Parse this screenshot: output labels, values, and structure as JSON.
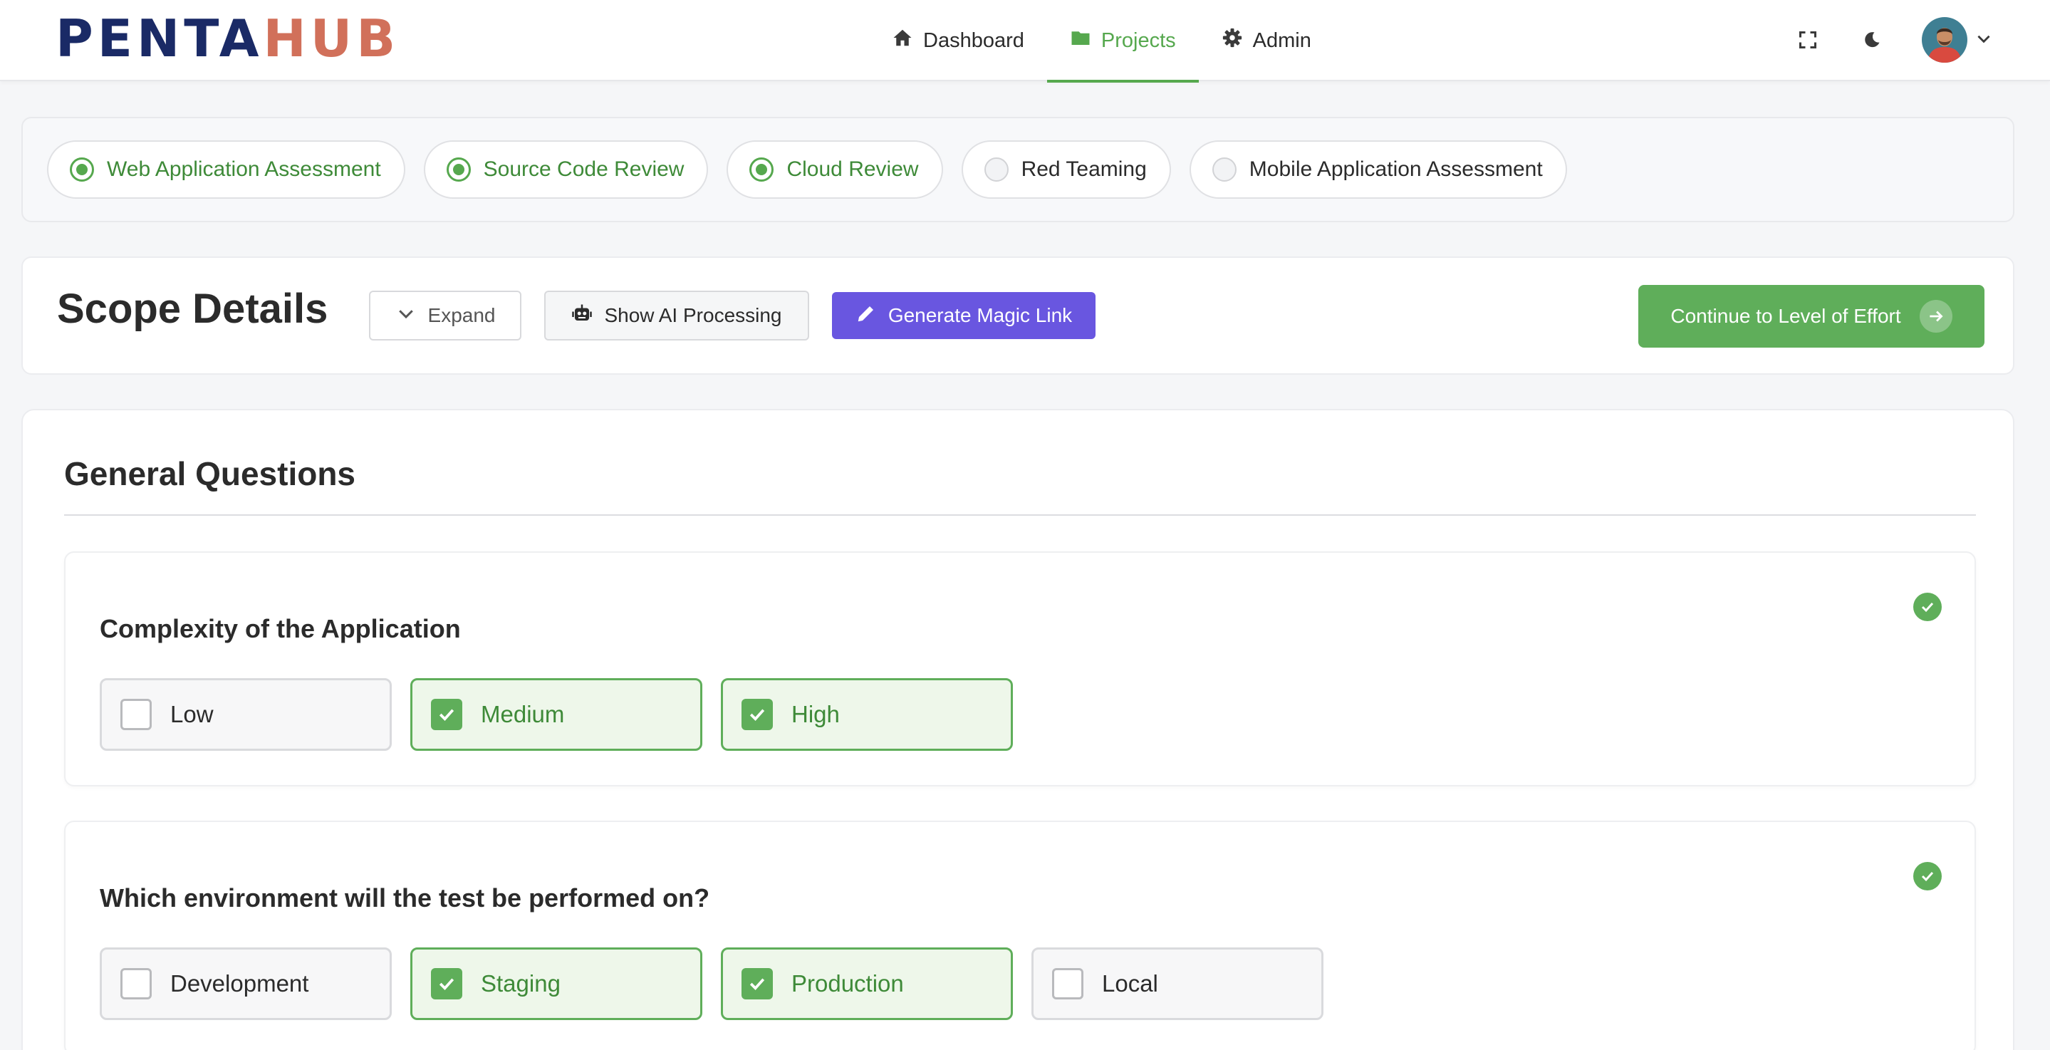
{
  "brand": {
    "logo_part1": "PENTA",
    "logo_part2": "HUB"
  },
  "nav": {
    "items": [
      {
        "label": "Dashboard",
        "icon": "home-icon",
        "active": false
      },
      {
        "label": "Projects",
        "icon": "folder-icon",
        "active": true
      },
      {
        "label": "Admin",
        "icon": "gear-icon",
        "active": false
      }
    ]
  },
  "top_actions": {
    "fullscreen_icon": "fullscreen-icon",
    "theme_icon": "moon-icon",
    "avatar_icon": "user-avatar",
    "menu_icon": "chevron-down-icon"
  },
  "services": [
    {
      "label": "Web Application Assessment",
      "selected": true
    },
    {
      "label": "Source Code Review",
      "selected": true
    },
    {
      "label": "Cloud Review",
      "selected": true
    },
    {
      "label": "Red Teaming",
      "selected": false
    },
    {
      "label": "Mobile Application Assessment",
      "selected": false
    }
  ],
  "scope": {
    "title": "Scope Details",
    "expand_label": "Expand",
    "ai_label": "Show AI Processing",
    "magic_label": "Generate Magic Link",
    "continue_label": "Continue to Level of Effort"
  },
  "general": {
    "title": "General Questions",
    "questions": [
      {
        "text": "Complexity of the Application",
        "answered": true,
        "options": [
          {
            "label": "Low",
            "checked": false
          },
          {
            "label": "Medium",
            "checked": true
          },
          {
            "label": "High",
            "checked": true
          }
        ]
      },
      {
        "text": "Which environment will the test be performed on?",
        "answered": true,
        "options": [
          {
            "label": "Development",
            "checked": false
          },
          {
            "label": "Staging",
            "checked": true
          },
          {
            "label": "Production",
            "checked": true
          },
          {
            "label": "Local",
            "checked": false
          }
        ]
      }
    ]
  },
  "colors": {
    "accent_green": "#5fae5a",
    "brand_navy": "#1a2a66",
    "brand_coral": "#d1705a",
    "magic_purple": "#6956e0"
  }
}
